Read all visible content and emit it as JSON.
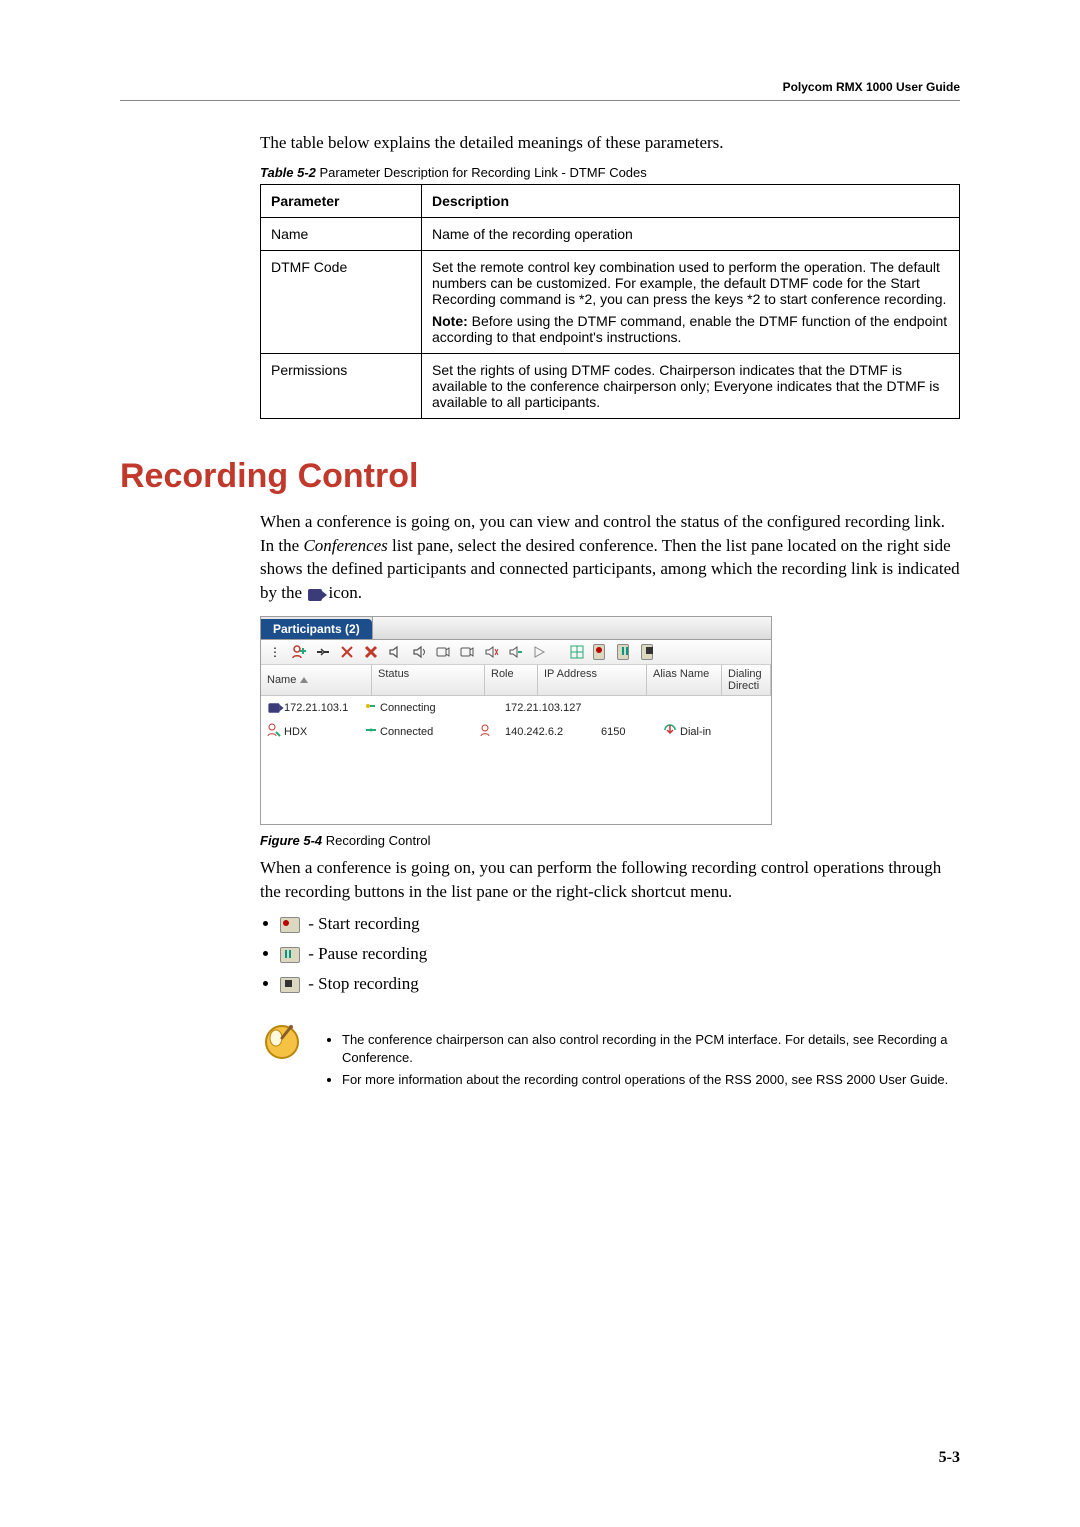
{
  "header": {
    "title": "Polycom RMX 1000 User Guide"
  },
  "intro_para": "The table below explains the detailed meanings of these parameters.",
  "table_caption": {
    "label": "Table 5-2",
    "text": " Parameter Description for Recording Link - DTMF Codes"
  },
  "param_table": {
    "head": {
      "param": "Parameter",
      "desc": "Description"
    },
    "rows": [
      {
        "param": "Name",
        "desc": "Name of the recording operation"
      },
      {
        "param": "DTMF Code",
        "desc_p1": "Set the remote control key combination used to perform the operation. The default numbers can be customized. For example, the default DTMF code for the Start Recording command is *2, you can press the keys *2 to start conference recording.",
        "desc_p2_bold": "Note:",
        "desc_p2_rest": " Before using the DTMF command, enable the DTMF function of the endpoint according to that endpoint's instructions."
      },
      {
        "param": "Permissions",
        "desc": "Set the rights of using DTMF codes. Chairperson indicates that the DTMF is available to the conference chairperson only; Everyone indicates that the DTMF is available to all participants."
      }
    ]
  },
  "section_heading": "Recording Control",
  "body_para1_pre": "When a conference is going on, you can view and control the status of the configured recording link. In the ",
  "body_para1_em": "Conferences",
  "body_para1_post": " list pane, select the desired conference. Then the list pane located on the right side shows the defined participants and connected participants, among which the recording link is indicated by the ",
  "body_para1_tail": " icon.",
  "screenshot": {
    "tab": "Participants (2)",
    "columns": {
      "name": "Name",
      "status": "Status",
      "role": "Role",
      "ip": "IP Address",
      "alias": "Alias Name",
      "dial": "Dialing Directi"
    },
    "rows": [
      {
        "name": "172.21.103.1",
        "status": "Connecting",
        "role": "",
        "ip": "172.21.103.127",
        "alias": "",
        "dial": ""
      },
      {
        "name": "HDX",
        "status": "Connected",
        "role": "role-icon",
        "ip": "140.242.6.2",
        "alias": "6150",
        "dial": "Dial-in"
      }
    ]
  },
  "fig_caption": {
    "label": "Figure 5-4",
    "text": "  Recording Control"
  },
  "body_para2": "When a conference is going on, you can perform the following recording control operations through the recording buttons in the list pane or the right-click shortcut menu.",
  "ops": [
    {
      "label": " - Start recording"
    },
    {
      "label": " - Pause recording"
    },
    {
      "label": " - Stop recording"
    }
  ],
  "notes": [
    "The conference chairperson can also control recording in the PCM interface. For details, see Recording a Conference.",
    "For more information about the recording control operations of the RSS 2000, see RSS 2000 User Guide."
  ],
  "page_num": "5-3"
}
